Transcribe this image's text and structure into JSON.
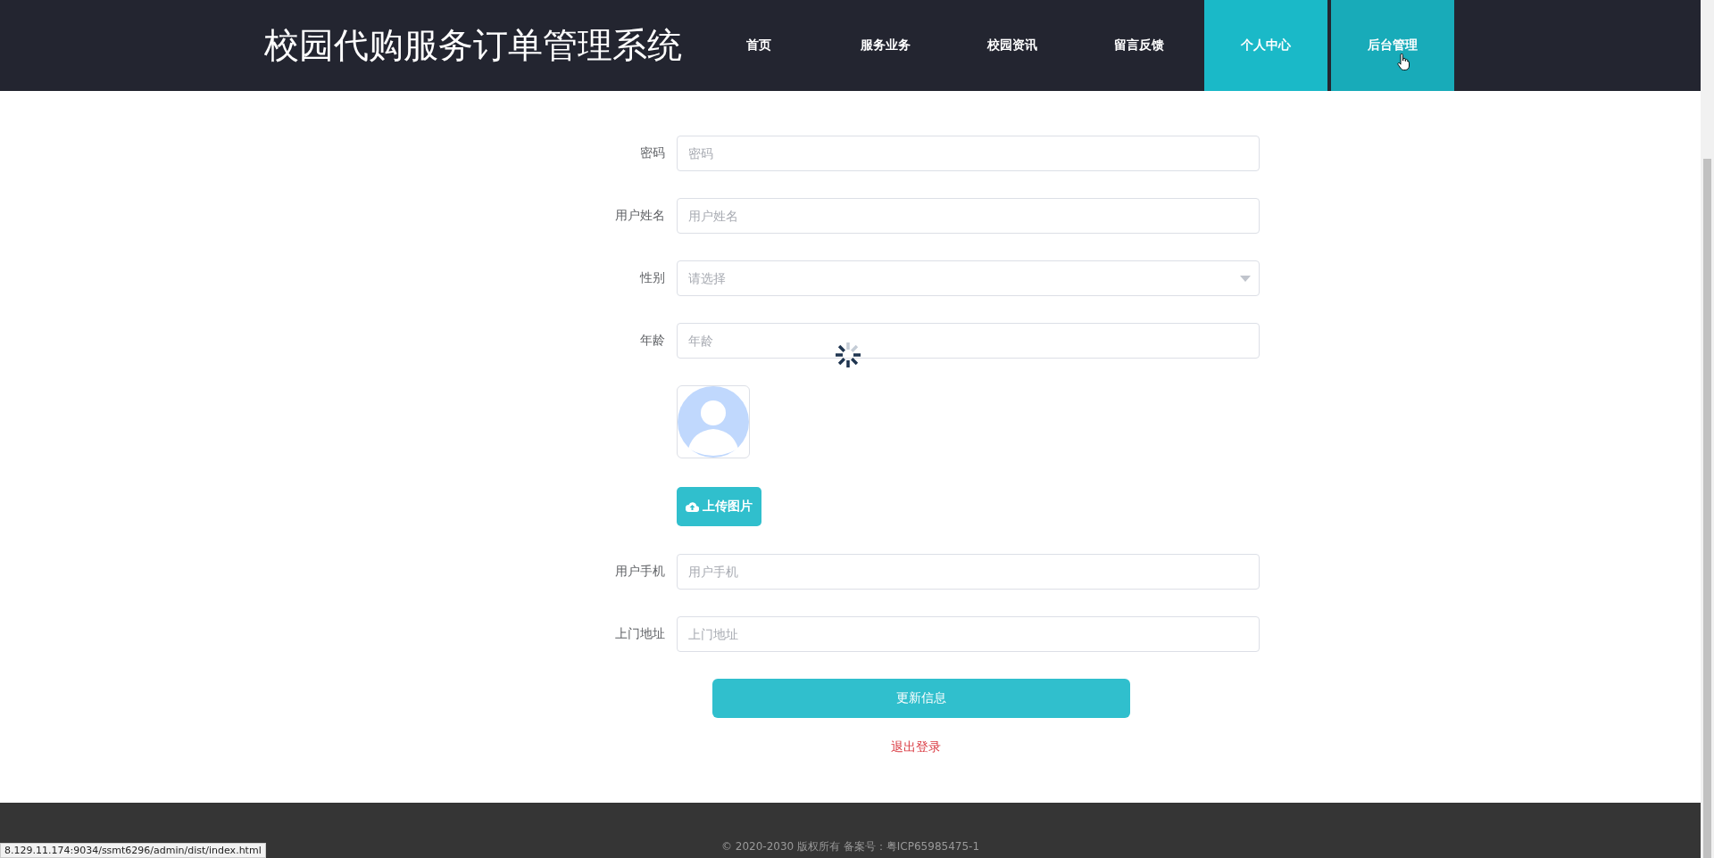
{
  "header": {
    "title": "校园代购服务订单管理系统",
    "nav": [
      {
        "label": "首页",
        "selected": false,
        "hovered": false
      },
      {
        "label": "服务业务",
        "selected": false,
        "hovered": false
      },
      {
        "label": "校园资讯",
        "selected": false,
        "hovered": false
      },
      {
        "label": "留言反馈",
        "selected": false,
        "hovered": false
      },
      {
        "label": "个人中心",
        "selected": true,
        "hovered": false
      },
      {
        "label": "后台管理",
        "selected": false,
        "hovered": true
      }
    ]
  },
  "form": {
    "rows": [
      {
        "kind": "input",
        "label": "密码",
        "placeholder": "密码"
      },
      {
        "kind": "input",
        "label": "用户姓名",
        "placeholder": "用户姓名"
      },
      {
        "kind": "select",
        "label": "性别",
        "placeholder": "请选择"
      },
      {
        "kind": "input",
        "label": "年龄",
        "placeholder": "年龄"
      },
      {
        "kind": "avatar"
      },
      {
        "kind": "upload",
        "label": "上传图片"
      },
      {
        "kind": "input",
        "label": "用户手机",
        "placeholder": "用户手机"
      },
      {
        "kind": "input",
        "label": "上门地址",
        "placeholder": "上门地址"
      }
    ],
    "submit": "更新信息",
    "logout": "退出登录"
  },
  "loading": true,
  "footer": "© 2020-2030 版权所有 备案号：粤ICP65985475-1",
  "status_url": "8.129.11.174:9034/ssmt6296/admin/dist/index.html"
}
